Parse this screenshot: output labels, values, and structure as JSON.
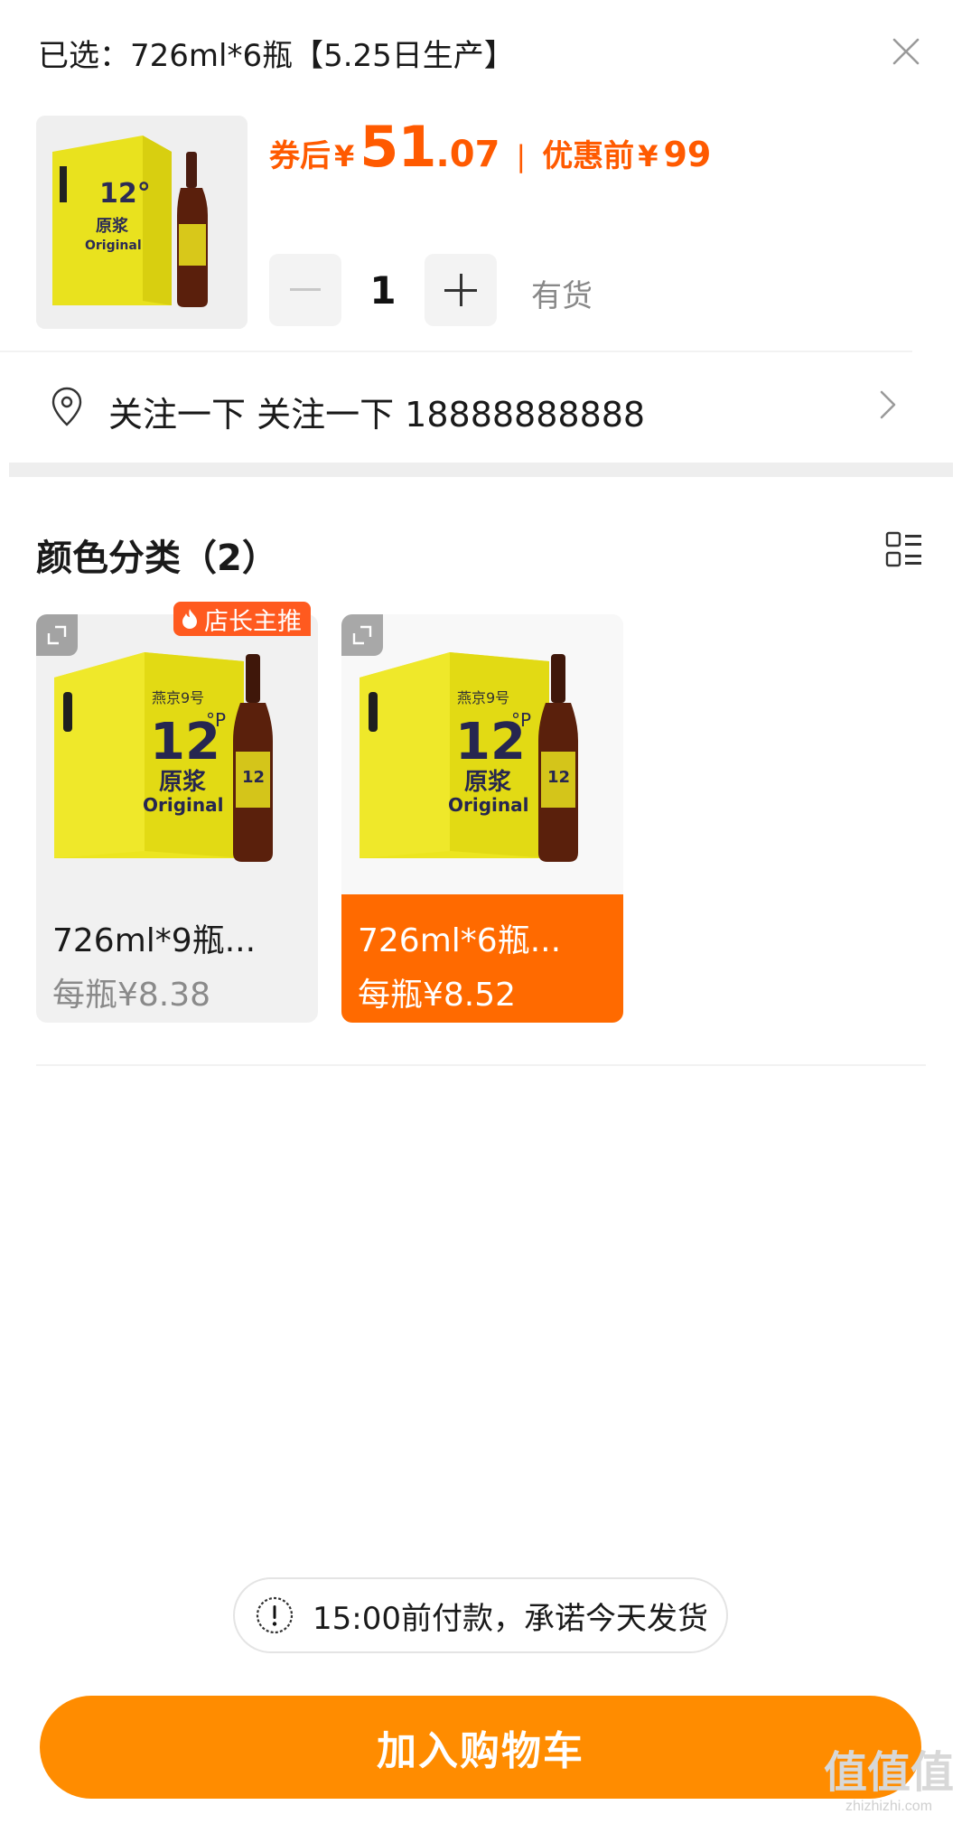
{
  "header": {
    "selected_label": "已选：726ml*6瓶【5.25日生产】",
    "close_icon": "close-icon"
  },
  "price": {
    "after_coupon_label": "券后",
    "currency": "¥",
    "integer": "51",
    "decimal": ".07",
    "separator": "|",
    "before_label": "优惠前",
    "before_value": "99",
    "color": "#ff5a00"
  },
  "quantity": {
    "value": "1",
    "stock_status": "有货"
  },
  "address": {
    "text": "关注一下 关注一下 18888888888"
  },
  "variants": {
    "section_title": "颜色分类（2）",
    "items": [
      {
        "name": "726ml*9瓶...",
        "price": "每瓶¥8.38",
        "badge": "店长主推",
        "selected": false
      },
      {
        "name": "726ml*6瓶...",
        "price": "每瓶¥8.52",
        "selected": true
      }
    ],
    "selected_color": "#ff6a00"
  },
  "notice": {
    "text": "15:00前付款，承诺今天发货"
  },
  "actions": {
    "add_to_cart": "加入购物车",
    "button_color": "#ff8c00"
  },
  "watermark": {
    "logo_text": "值值值",
    "site": "zhizhizhi.com"
  }
}
